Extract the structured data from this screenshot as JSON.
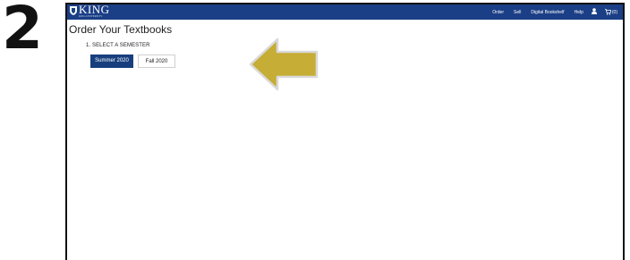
{
  "step": {
    "number": "2"
  },
  "brand": {
    "name": "KING",
    "tagline": "KING UNIVERSITY"
  },
  "nav": {
    "links": [
      "Order",
      "Sell",
      "Digital Bookshelf",
      "Help"
    ],
    "cart_label": "(0)",
    "background": "#1b3f86"
  },
  "page": {
    "title": "Order Your Textbooks",
    "section_label": "1. SELECT A SEMESTER",
    "semesters": [
      {
        "label": "Summer 2020",
        "selected": true
      },
      {
        "label": "Fall 2020",
        "selected": false
      }
    ]
  },
  "colors": {
    "arrow": "#c6ad35",
    "selected_button": "#173f7e"
  },
  "icons": {
    "user": "user-icon",
    "cart": "cart-icon",
    "pointer": "arrow-left-icon"
  }
}
